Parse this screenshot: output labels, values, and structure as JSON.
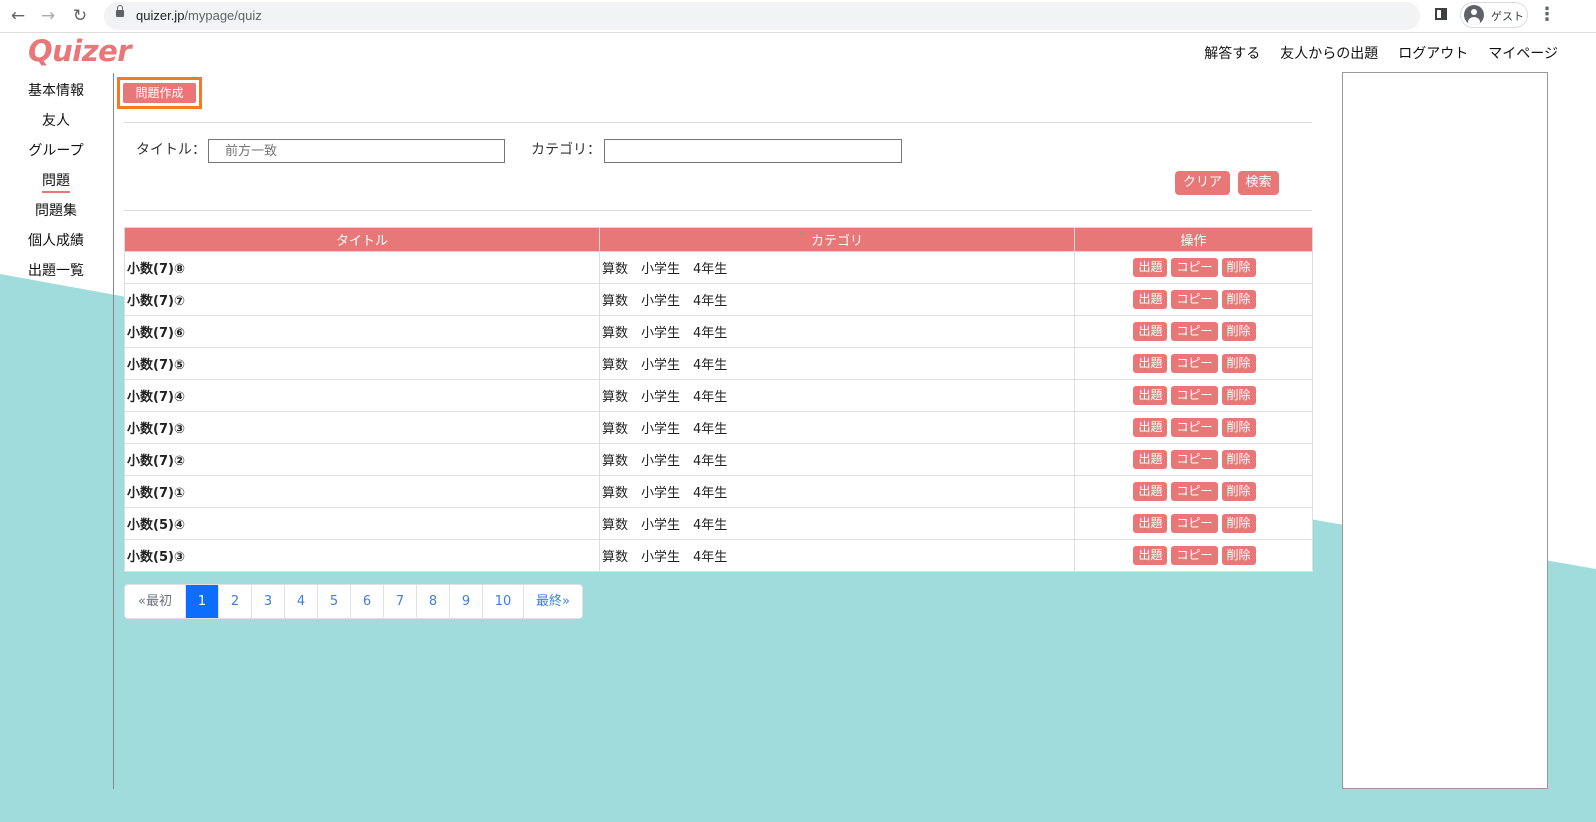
{
  "browser": {
    "url_host": "quizer.jp",
    "url_path": "/mypage/quiz",
    "profile_label": "ゲスト"
  },
  "site": {
    "logo": "Quizer",
    "topnav": [
      "解答する",
      "友人からの出題",
      "ログアウト",
      "マイページ"
    ]
  },
  "sidebar": {
    "items": [
      {
        "label": "基本情報"
      },
      {
        "label": "友人"
      },
      {
        "label": "グループ"
      },
      {
        "label": "問題",
        "active": true
      },
      {
        "label": "問題集"
      },
      {
        "label": "個人成績"
      },
      {
        "label": "出題一覧"
      }
    ]
  },
  "main": {
    "create_button": "問題作成",
    "filter": {
      "title_label": "タイトル：",
      "title_placeholder": "前方一致",
      "category_label": "カテゴリ：",
      "category_value": "",
      "clear_button": "クリア",
      "search_button": "検索"
    },
    "table": {
      "headers": [
        "タイトル",
        "カテゴリ",
        "操作"
      ],
      "op_labels": {
        "assign": "出題",
        "copy": "コピー",
        "delete": "削除"
      },
      "rows": [
        {
          "title": "小数(7)⑧",
          "category": "算数　小学生　4年生"
        },
        {
          "title": "小数(7)⑦",
          "category": "算数　小学生　4年生"
        },
        {
          "title": "小数(7)⑥",
          "category": "算数　小学生　4年生"
        },
        {
          "title": "小数(7)⑤",
          "category": "算数　小学生　4年生"
        },
        {
          "title": "小数(7)④",
          "category": "算数　小学生　4年生"
        },
        {
          "title": "小数(7)③",
          "category": "算数　小学生　4年生"
        },
        {
          "title": "小数(7)②",
          "category": "算数　小学生　4年生"
        },
        {
          "title": "小数(7)①",
          "category": "算数　小学生　4年生"
        },
        {
          "title": "小数(5)④",
          "category": "算数　小学生　4年生"
        },
        {
          "title": "小数(5)③",
          "category": "算数　小学生　4年生"
        }
      ]
    },
    "pagination": {
      "first": "«最初",
      "pages": [
        "1",
        "2",
        "3",
        "4",
        "5",
        "6",
        "7",
        "8",
        "9",
        "10"
      ],
      "current": "1",
      "last": "最終»"
    }
  },
  "colors": {
    "accent": "#e87878",
    "background_wave": "#a0dcdc",
    "highlight_border": "#f47b20",
    "pagination_active": "#0d6efd"
  }
}
